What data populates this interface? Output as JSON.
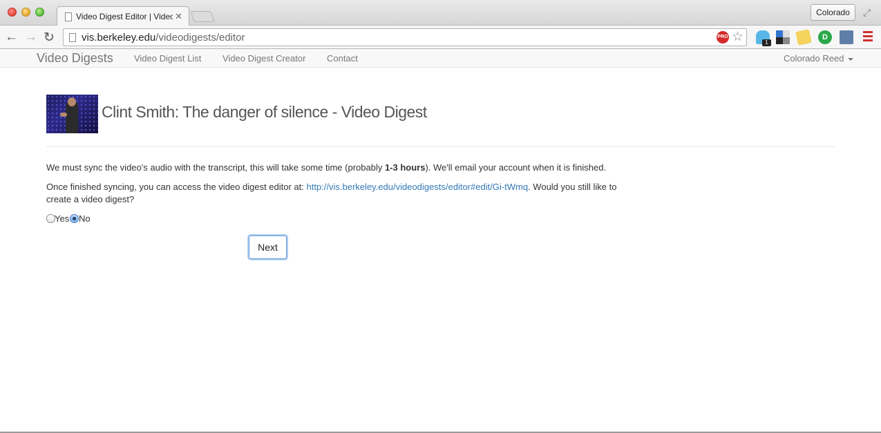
{
  "browser": {
    "tab_title": "Video Digest Editor | Video Digests",
    "tab_close": "✕",
    "profile_button": "Colorado",
    "url_host": "vis.berkeley.edu",
    "url_path": "/videodigests/editor",
    "pro_badge": "PRO",
    "extension_badge": "1",
    "icons": [
      "back-arrow-icon",
      "forward-arrow-icon",
      "reload-icon",
      "page-icon",
      "star-icon",
      "menu-icon"
    ]
  },
  "navbar": {
    "brand": "Video Digests",
    "links": [
      "Video Digest List",
      "Video Digest Creator",
      "Contact"
    ],
    "user": "Colorado Reed"
  },
  "main": {
    "title": "Clint Smith: The danger of silence - Video Digest",
    "sync_text_before": "We must sync the video's audio with the transcript, this will take some time (probably ",
    "sync_duration": "1-3 hours",
    "sync_text_after": "). We'll email your account when it is finished.",
    "editor_text_before": "Once finished syncing, you can access the video digest editor at: ",
    "editor_link": "http://vis.berkeley.edu/videodigests/editor#edit/Gi-tWmq",
    "editor_text_after": ". Would you still like to create a video digest?",
    "options": [
      {
        "label": "Yes",
        "selected": false
      },
      {
        "label": "No",
        "selected": true
      }
    ],
    "next_button": "Next"
  },
  "colors": {
    "link": "#337ab7",
    "title": "#555555",
    "nav_text": "#777777"
  }
}
